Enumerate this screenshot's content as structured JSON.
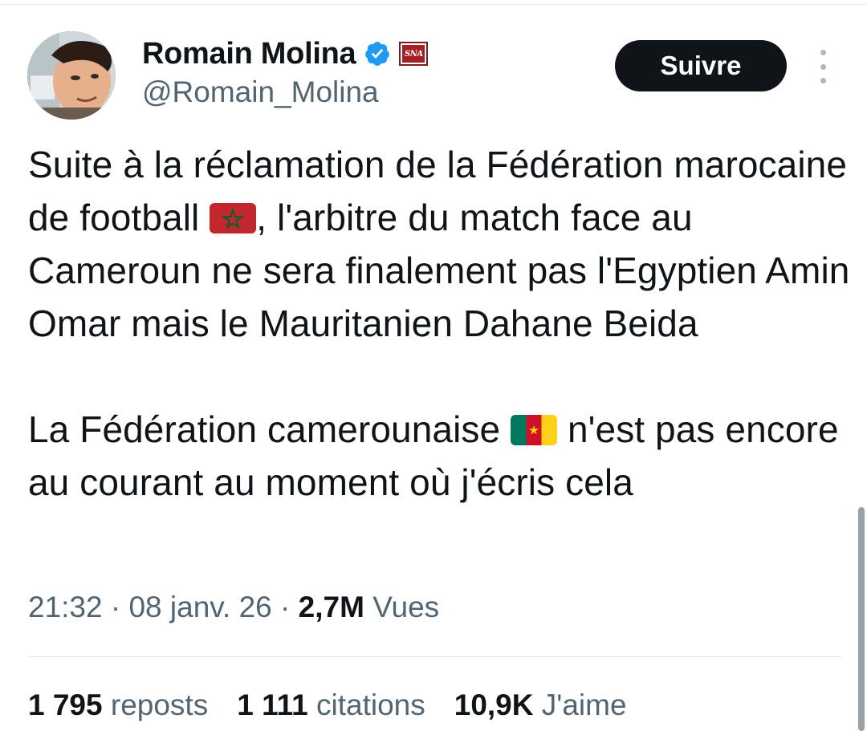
{
  "author": {
    "display_name": "Romain Molina",
    "handle": "@Romain_Molina",
    "verified_icon": "verified-badge-icon",
    "affiliation_badge_text": "SNA"
  },
  "actions": {
    "follow_label": "Suivre",
    "more_icon": "more-vertical-icon"
  },
  "tweet": {
    "p1_before_flag": "Suite à la réclamation de la Fédération marocaine de football ",
    "p1_after_flag": ", l'arbitre du match face au Cameroun ne sera finalement pas l'Egyptien Amin Omar mais le Mauritanien Dahane Beida",
    "p2_before_flag": "La Fédération camerounaise ",
    "p2_after_flag": " n'est pas encore au courant au moment où j'écris cela",
    "flag1": "morocco-flag-emoji",
    "flag2": "cameroon-flag-emoji"
  },
  "meta": {
    "time": "21:32",
    "sep1": " · ",
    "date": "08 janv. 26",
    "sep2": " · ",
    "views_count": "2,7M",
    "views_label": " Vues"
  },
  "stats": {
    "reposts_count": "1 795",
    "reposts_label": " reposts",
    "quotes_count": "1 111",
    "quotes_label": " citations",
    "likes_count": "10,9K",
    "likes_label": " J'aime"
  },
  "colors": {
    "text_primary": "#0f1419",
    "text_secondary": "#536471",
    "verified_blue": "#1d9bf0",
    "button_bg": "#0f1419"
  }
}
